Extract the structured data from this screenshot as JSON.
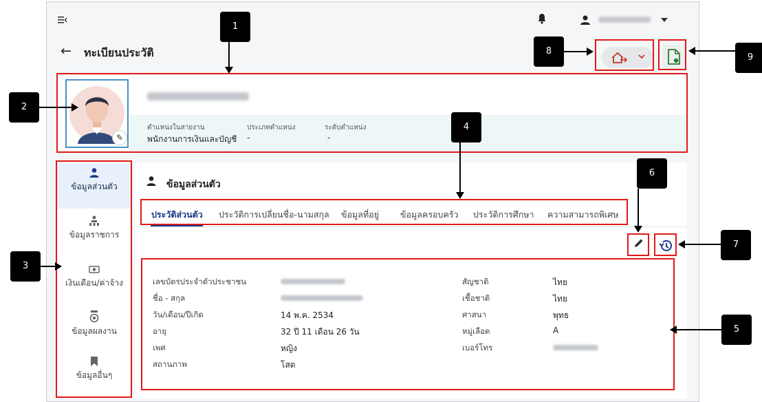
{
  "header": {
    "title": "ทะเบียนประวัติ"
  },
  "profile": {
    "position_label": "ตำแหน่งในสายงาน",
    "position_value": "พนักงานการเงินและบัญชี",
    "type_label": "ประเภทตำแหน่ง",
    "type_value": "-",
    "level_label": "ระดับตำแหน่ง",
    "level_value": "-"
  },
  "sidebar": {
    "items": [
      {
        "label": "ข้อมูลส่วนตัว",
        "icon": "person-icon",
        "active": true
      },
      {
        "label": "ข้อมูลราชการ",
        "icon": "org-icon",
        "active": false
      },
      {
        "label": "เงินเดือน/ค่าจ้าง",
        "icon": "money-icon",
        "active": false
      },
      {
        "label": "ข้อมูลผลงาน",
        "icon": "medal-icon",
        "active": false
      },
      {
        "label": "ข้อมูลอื่นๆ",
        "icon": "bookmark-icon",
        "active": false
      }
    ]
  },
  "section": {
    "title": "ข้อมูลส่วนตัว",
    "tabs": [
      {
        "label": "ประวัติส่วนตัว",
        "active": true
      },
      {
        "label": "ประวัติการเปลี่ยนชื่อ-นามสกุล",
        "active": false
      },
      {
        "label": "ข้อมูลที่อยู่",
        "active": false
      },
      {
        "label": "ข้อมูลครอบครัว",
        "active": false
      },
      {
        "label": "ประวัติการศึกษา",
        "active": false
      },
      {
        "label": "ความสามารถพิเศษ",
        "active": false
      }
    ]
  },
  "info": {
    "left": [
      {
        "label": "เลขบัตรประจำตัวประชาชน",
        "value": ""
      },
      {
        "label": "ชื่อ - สกุล",
        "value": ""
      },
      {
        "label": "วัน/เดือน/ปีเกิด",
        "value": "14 พ.ค. 2534"
      },
      {
        "label": "อายุ",
        "value": "32 ปี 11 เดือน 26 วัน"
      },
      {
        "label": "เพศ",
        "value": "หญิง"
      },
      {
        "label": "สถานภาพ",
        "value": "โสด"
      }
    ],
    "right": [
      {
        "label": "สัญชาติ",
        "value": "ไทย"
      },
      {
        "label": "เชื้อชาติ",
        "value": "ไทย"
      },
      {
        "label": "ศาสนา",
        "value": "พุทธ"
      },
      {
        "label": "หมู่เลือด",
        "value": "A"
      },
      {
        "label": "เบอร์โทร",
        "value": ""
      }
    ]
  },
  "annotations": {
    "n1": "1",
    "n2": "2",
    "n3": "3",
    "n4": "4",
    "n5": "5",
    "n6": "6",
    "n7": "7",
    "n8": "8",
    "n9": "9"
  },
  "colors": {
    "accent": "#1a3a8a",
    "highlight": "#e01919",
    "profile_band": "#eef7f7",
    "active_side": "#e8f0fb"
  }
}
